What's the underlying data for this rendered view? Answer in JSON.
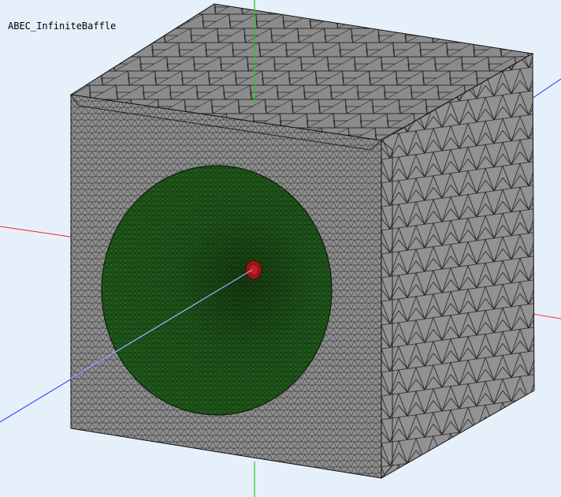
{
  "window": {
    "title": "ABEC_InfiniteBaffle"
  },
  "colors": {
    "background": "#e6f0fb",
    "mesh_face": "#8c8c8c",
    "mesh_face_side": "#909090",
    "mesh_face_top": "#8a8a8a",
    "mesh_edge": "#1c1c1c",
    "cone": "#1f5a1a",
    "cone_edge": "#0b1f09",
    "dust_cap": "#a01818",
    "axis_x": "#ff2020",
    "axis_y": "#20d020",
    "axis_z": "#2030ff"
  },
  "scene": {
    "icons": {
      "mesh": "triangle-mesh",
      "cone": "speaker-cone",
      "axes": "xyz-axes"
    }
  }
}
